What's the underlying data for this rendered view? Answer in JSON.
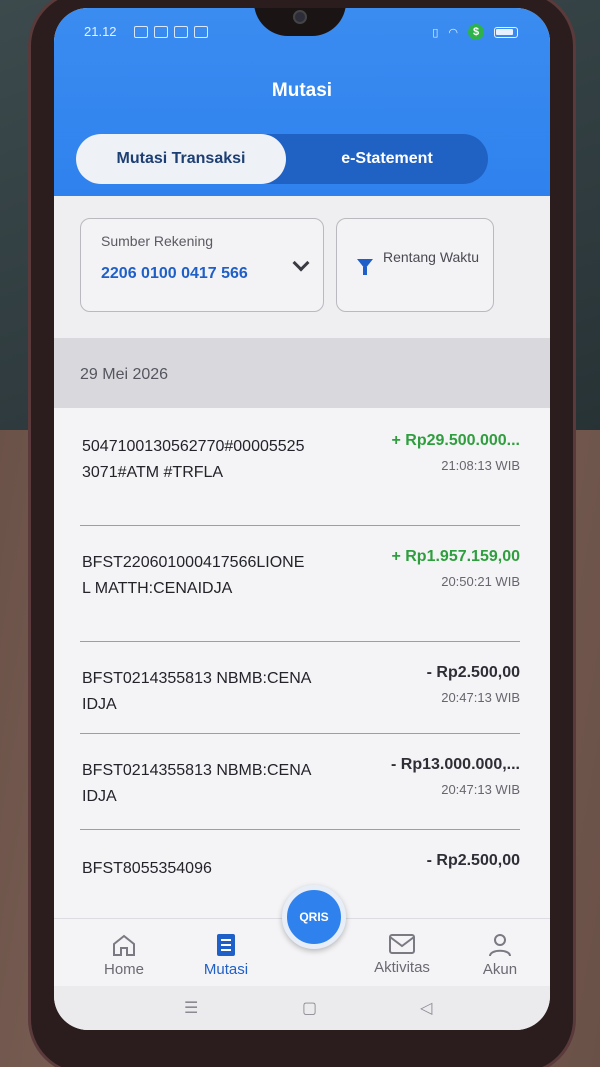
{
  "status_bar": {
    "time": "21.12"
  },
  "header": {
    "title": "Mutasi",
    "tabs": [
      {
        "label": "Mutasi Transaksi",
        "active": true
      },
      {
        "label": "e-Statement",
        "active": false
      }
    ]
  },
  "filters": {
    "source_label": "Sumber Rekening",
    "source_value": "2206 0100 0417 566",
    "range_label": "Rentang Waktu"
  },
  "date_group": "29 Mei 2026",
  "transactions": [
    {
      "description": "5047100130562770#000055253071#ATM #TRFLA",
      "amount": "+ Rp29.500.000...",
      "time": "21:08:13 WIB",
      "type": "credit"
    },
    {
      "description": "BFST220601000417566LIONEL MATTH:CENAIDJA",
      "amount": "+ Rp1.957.159,00",
      "time": "20:50:21 WIB",
      "type": "credit"
    },
    {
      "description": "BFST0214355813 NBMB:CENAIDJA",
      "amount": "- Rp2.500,00",
      "time": "20:47:13 WIB",
      "type": "debit"
    },
    {
      "description": "BFST0214355813 NBMB:CENAIDJA",
      "amount": "- Rp13.000.000,...",
      "time": "20:47:13 WIB",
      "type": "debit"
    },
    {
      "description": "BFST8055354096",
      "amount": "- Rp2.500,00",
      "time": "",
      "type": "debit"
    }
  ],
  "bottom_nav": {
    "items": [
      {
        "label": "Home",
        "icon": "home-icon"
      },
      {
        "label": "Mutasi",
        "icon": "list-icon"
      },
      {
        "label": "Aktivitas",
        "icon": "mail-icon"
      },
      {
        "label": "Akun",
        "icon": "user-icon"
      }
    ],
    "qris_label": "QRIS"
  },
  "colors": {
    "header_blue": "#2f82ee",
    "credit_green": "#2f9e3e",
    "link_blue": "#1f5fc8"
  }
}
